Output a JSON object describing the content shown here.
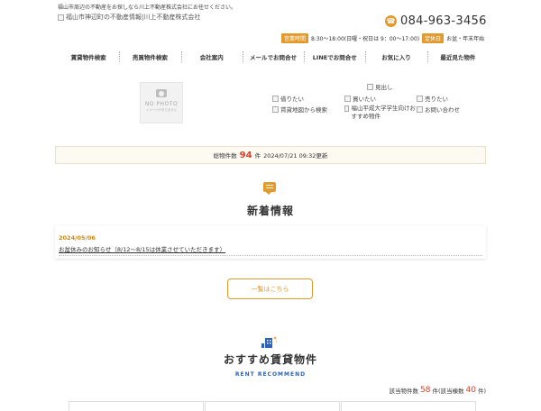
{
  "header": {
    "tagline": "福山市周辺の不動産をお探しなら川上不動産株式会社にお任せください。",
    "logo_alt": "福山市神辺町の不動産情報|川上不動産株式会社",
    "phone": "084-963-3456",
    "hours_label": "営業時間",
    "hours": "8:30～18:00(日曜・祝日は 9：00～17:00)",
    "holiday_label": "定休日",
    "holiday": "お盆・年末年始"
  },
  "nav": {
    "items": [
      "賃貸物件検索",
      "売買物件検索",
      "会社案内",
      "メールでお問合せ",
      "LINEでお問合せ",
      "お気に入り",
      "最近見た物件"
    ]
  },
  "banner": {
    "nophoto_text": "NO PHOTO",
    "nophoto_sub": "イメージがありません",
    "midashi": "見出し",
    "links": {
      "rent": "借りたい",
      "buy": "買いたい",
      "sell": "売りたい",
      "map": "賃貸地図から検索",
      "student": "福山平成大学学生向けおすすめ物件",
      "contact": "お問い合わせ"
    }
  },
  "count_bar": {
    "label": "総物件数",
    "count": "94",
    "unit": "件",
    "updated": "2024/07/21 09:32更新"
  },
  "news": {
    "heading": "新着情報",
    "items": [
      {
        "date": "2024/05/06",
        "title": "お盆休みのお知らせ（8/12～8/15は休業させていただきます）"
      }
    ],
    "more_label": "一覧はこちら"
  },
  "recommend": {
    "heading": "おすすめ賃貸物件",
    "subheading": "RENT RECOMMEND",
    "hit_label": "該当物件数",
    "hit_count": "58",
    "hit_unit": "件(該当棟数",
    "bldg_count": "40",
    "bldg_unit": "件)"
  },
  "colors": {
    "accent": "#e39a2d",
    "highlight": "#d8402a",
    "english": "#2a62b8"
  },
  "icons": [
    "phone-icon",
    "camera-icon",
    "chat-icon",
    "building-icon",
    "broken-image-icon"
  ]
}
